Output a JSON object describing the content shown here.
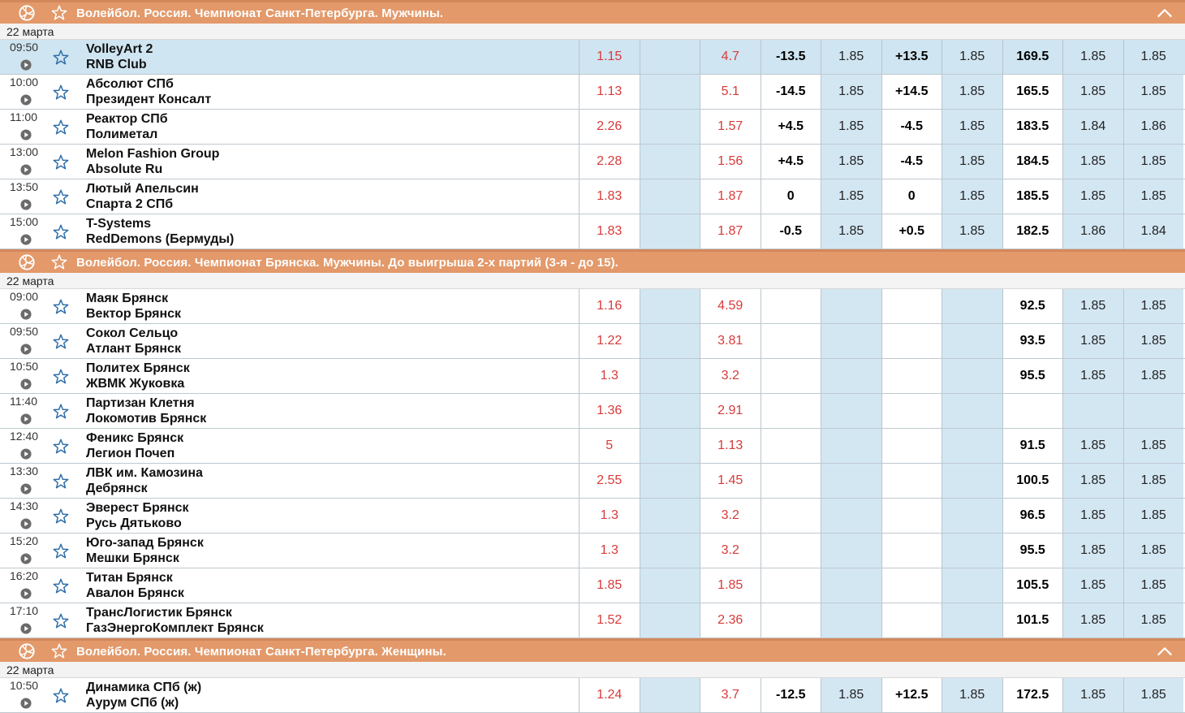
{
  "colors": {
    "header": "#e3996a",
    "selected_row": "#cfe5f1",
    "odds_red": "#d93a3a",
    "blue_col": "#d3e7f3"
  },
  "icons": {
    "sport": "volleyball-icon",
    "favorite": "star-icon",
    "live": "play-circle-icon",
    "collapse": "chevron-up-icon"
  },
  "leagues": [
    {
      "title": "Волейбол. Россия. Чемпионат Санкт-Петербурга. Мужчины.",
      "date": "22 марта",
      "collapsible": true,
      "matches": [
        {
          "time": "09:50",
          "team1": "VolleyArt 2",
          "team2": "RNB Club",
          "selected": true,
          "odds": [
            "1.15",
            "",
            "4.7",
            "-13.5",
            "1.85",
            "+13.5",
            "1.85",
            "169.5",
            "1.85",
            "1.85"
          ]
        },
        {
          "time": "10:00",
          "team1": "Абсолют СПб",
          "team2": "Президент Консалт",
          "odds": [
            "1.13",
            "",
            "5.1",
            "-14.5",
            "1.85",
            "+14.5",
            "1.85",
            "165.5",
            "1.85",
            "1.85"
          ]
        },
        {
          "time": "11:00",
          "team1": "Реактор СПб",
          "team2": "Полиметал",
          "odds": [
            "2.26",
            "",
            "1.57",
            "+4.5",
            "1.85",
            "-4.5",
            "1.85",
            "183.5",
            "1.84",
            "1.86"
          ]
        },
        {
          "time": "13:00",
          "team1": "Melon Fashion Group",
          "team2": "Absolute Ru",
          "odds": [
            "2.28",
            "",
            "1.56",
            "+4.5",
            "1.85",
            "-4.5",
            "1.85",
            "184.5",
            "1.85",
            "1.85"
          ]
        },
        {
          "time": "13:50",
          "team1": "Лютый Апельсин",
          "team2": "Спарта 2 СПб",
          "odds": [
            "1.83",
            "",
            "1.87",
            "0",
            "1.85",
            "0",
            "1.85",
            "185.5",
            "1.85",
            "1.85"
          ]
        },
        {
          "time": "15:00",
          "team1": "T-Systems",
          "team2": "RedDemons (Бермуды)",
          "odds": [
            "1.83",
            "",
            "1.87",
            "-0.5",
            "1.85",
            "+0.5",
            "1.85",
            "182.5",
            "1.86",
            "1.84"
          ]
        }
      ]
    },
    {
      "title": "Волейбол. Россия. Чемпионат Брянска. Мужчины. До выигрыша 2-х партий (3-я - до 15).",
      "date": "22 марта",
      "collapsible": false,
      "matches": [
        {
          "time": "09:00",
          "team1": "Маяк Брянск",
          "team2": "Вектор Брянск",
          "odds": [
            "1.16",
            "",
            "4.59",
            "",
            "",
            "",
            "",
            "92.5",
            "1.85",
            "1.85"
          ]
        },
        {
          "time": "09:50",
          "team1": "Сокол Сельцо",
          "team2": "Атлант Брянск",
          "odds": [
            "1.22",
            "",
            "3.81",
            "",
            "",
            "",
            "",
            "93.5",
            "1.85",
            "1.85"
          ]
        },
        {
          "time": "10:50",
          "team1": "Политех Брянск",
          "team2": "ЖВМК Жуковка",
          "odds": [
            "1.3",
            "",
            "3.2",
            "",
            "",
            "",
            "",
            "95.5",
            "1.85",
            "1.85"
          ]
        },
        {
          "time": "11:40",
          "team1": "Партизан Клетня",
          "team2": "Локомотив Брянск",
          "odds": [
            "1.36",
            "",
            "2.91",
            "",
            "",
            "",
            "",
            "",
            "",
            ""
          ]
        },
        {
          "time": "12:40",
          "team1": "Феникс Брянск",
          "team2": "Легион Почеп",
          "odds": [
            "5",
            "",
            "1.13",
            "",
            "",
            "",
            "",
            "91.5",
            "1.85",
            "1.85"
          ]
        },
        {
          "time": "13:30",
          "team1": "ЛВК им. Камозина",
          "team2": "Дебрянск",
          "odds": [
            "2.55",
            "",
            "1.45",
            "",
            "",
            "",
            "",
            "100.5",
            "1.85",
            "1.85"
          ]
        },
        {
          "time": "14:30",
          "team1": "Эверест Брянск",
          "team2": "Русь Дятьково",
          "odds": [
            "1.3",
            "",
            "3.2",
            "",
            "",
            "",
            "",
            "96.5",
            "1.85",
            "1.85"
          ]
        },
        {
          "time": "15:20",
          "team1": "Юго-запад Брянск",
          "team2": "Мешки Брянск",
          "odds": [
            "1.3",
            "",
            "3.2",
            "",
            "",
            "",
            "",
            "95.5",
            "1.85",
            "1.85"
          ]
        },
        {
          "time": "16:20",
          "team1": "Титан Брянск",
          "team2": "Авалон Брянск",
          "odds": [
            "1.85",
            "",
            "1.85",
            "",
            "",
            "",
            "",
            "105.5",
            "1.85",
            "1.85"
          ]
        },
        {
          "time": "17:10",
          "team1": "ТрансЛогистик Брянск",
          "team2": "ГазЭнергоКомплект Брянск",
          "odds": [
            "1.52",
            "",
            "2.36",
            "",
            "",
            "",
            "",
            "101.5",
            "1.85",
            "1.85"
          ]
        }
      ]
    },
    {
      "title": "Волейбол. Россия. Чемпионат Санкт-Петербурга. Женщины.",
      "date": "22 марта",
      "collapsible": true,
      "matches": [
        {
          "time": "10:50",
          "team1": "Динамика СПб (ж)",
          "team2": "Аурум СПб (ж)",
          "odds": [
            "1.24",
            "",
            "3.7",
            "-12.5",
            "1.85",
            "+12.5",
            "1.85",
            "172.5",
            "1.85",
            "1.85"
          ]
        }
      ]
    }
  ]
}
